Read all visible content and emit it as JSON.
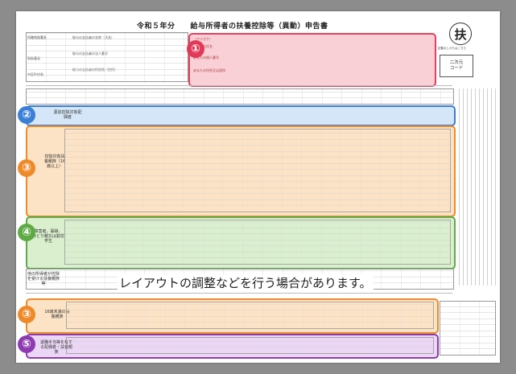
{
  "form": {
    "title": "令和５年分　　給与所得者の扶養控除等（異動）申告書",
    "kanji": "扶",
    "kanji_sub": "記載のしかたはこちら",
    "code_label": "二次元\nコード"
  },
  "header": {
    "office_label": "所轄税務署長",
    "payer_name_label": "給与の支払者の名称（氏名）",
    "payer_number_label": "給与の支払者の法人番号",
    "payer_address_label": "給与の支払者の所在地（住所）",
    "tax_office_label": "税務署長",
    "city_label": "市区町村長",
    "applicant_furigana": "（フリガナ）",
    "applicant_name": "あなたの氏名",
    "applicant_number": "あなたの個人番号",
    "applicant_address": "あなたの住所又は居所"
  },
  "section_labels": {
    "s2": "源泉控除対象配偶者",
    "s3": "控除対象扶養親族（16歳以上）",
    "s4": "障害者、寡婦、ひとり親又は勤労学生",
    "s5": "他の所得者が控除を受ける扶養親族等",
    "s3b": "16歳未満の扶養親族",
    "s5b": "退職手当等を有する配偶者・扶養親族"
  },
  "callouts": [
    {
      "number": "①",
      "color": "#e03a58"
    },
    {
      "number": "②",
      "color": "#3b7fd6"
    },
    {
      "number": "③",
      "color": "#ef8a2a"
    },
    {
      "number": "④",
      "color": "#5eab45"
    },
    {
      "number": "③",
      "color": "#ef8a2a"
    },
    {
      "number": "⑤",
      "color": "#8d3bb0"
    }
  ],
  "notice": "レイアウトの調整などを行う場合があります。"
}
